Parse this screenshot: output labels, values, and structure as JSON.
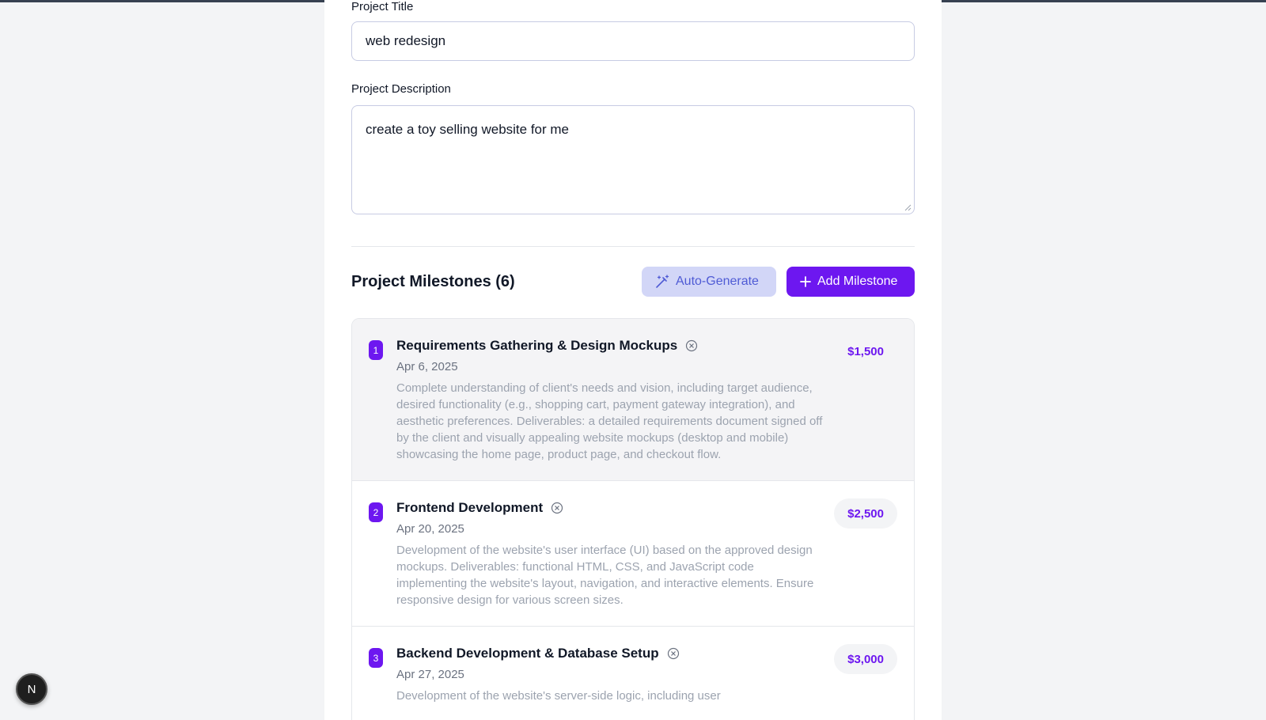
{
  "form": {
    "title_label": "Project Title",
    "title_value": "web redesign",
    "description_label": "Project Description",
    "description_value": "create a toy selling website for me"
  },
  "milestones_section": {
    "heading": "Project Milestones (6)",
    "auto_generate_label": "Auto-Generate",
    "add_milestone_label": "Add Milestone",
    "accent_color": "#6d17f0"
  },
  "milestones": [
    {
      "number": "1",
      "title": "Requirements Gathering & Design Mockups",
      "date": "Apr 6, 2025",
      "description": "Complete understanding of client's needs and vision, including target audience, desired functionality (e.g., shopping cart, payment gateway integration), and aesthetic preferences. Deliverables: a detailed requirements document signed off by the client and visually appealing website mockups (desktop and mobile) showcasing the home page, product page, and checkout flow.",
      "amount": "$1,500"
    },
    {
      "number": "2",
      "title": "Frontend Development",
      "date": "Apr 20, 2025",
      "description": "Development of the website's user interface (UI) based on the approved design mockups. Deliverables: functional HTML, CSS, and JavaScript code implementing the website's layout, navigation, and interactive elements. Ensure responsive design for various screen sizes.",
      "amount": "$2,500"
    },
    {
      "number": "3",
      "title": "Backend Development & Database Setup",
      "date": "Apr 27, 2025",
      "description": "Development of the website's server-side logic, including user",
      "amount": "$3,000"
    }
  ],
  "dev_badge": {
    "letter": "N"
  }
}
